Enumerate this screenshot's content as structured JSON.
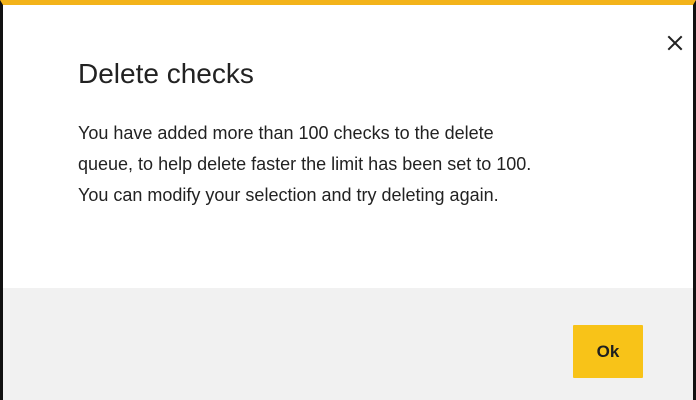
{
  "dialog": {
    "title": "Delete checks",
    "message_lines": [
      "You have added more than 100 checks to the delete",
      "queue, to help delete faster the limit has been set to 100.",
      "You can modify your selection and try deleting again."
    ],
    "close_icon": "close-icon",
    "ok_label": "Ok"
  },
  "colors": {
    "accent": "#f3b31a",
    "button": "#f8c318",
    "footer_background": "#f1f1f1",
    "text": "#222222"
  }
}
